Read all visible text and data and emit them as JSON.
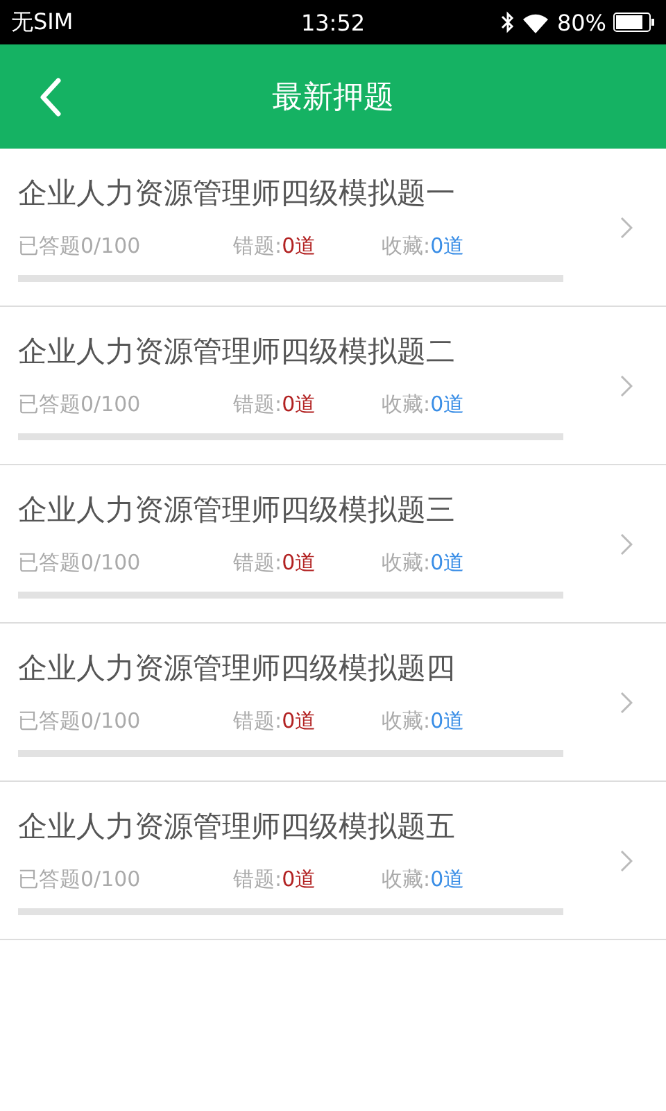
{
  "status_bar": {
    "carrier": "无SIM",
    "time": "13:52",
    "battery": "80%"
  },
  "header": {
    "title": "最新押题"
  },
  "items": [
    {
      "title": "企业人力资源管理师四级模拟题一",
      "answered": "已答题0/100",
      "wrong_label": "错题:",
      "wrong": "0道",
      "fav_label": "收藏:",
      "fav": "0道",
      "level": 0
    },
    {
      "title": "企业人力资源管理师四级模拟题二",
      "answered": "已答题0/100",
      "wrong_label": "错题:",
      "wrong": "0道",
      "fav_label": "收藏:",
      "fav": "0道",
      "level": 0
    },
    {
      "title": "企业人力资源管理师四级模拟题三",
      "answered": "已答题0/100",
      "wrong_label": "错题:",
      "wrong": "0道",
      "fav_label": "收藏:",
      "fav": "0道",
      "level": 0
    },
    {
      "title": "企业人力资源管理师四级模拟题四",
      "answered": "已答题0/100",
      "wrong_label": "错题:",
      "wrong": "0道",
      "fav_label": "收藏:",
      "fav": "0道",
      "level": 0
    },
    {
      "title": "企业人力资源管理师四级模拟题五",
      "answered": "已答题0/100",
      "wrong_label": "错题:",
      "wrong": "0道",
      "fav_label": "收藏:",
      "fav": "0道",
      "level": 0
    }
  ]
}
